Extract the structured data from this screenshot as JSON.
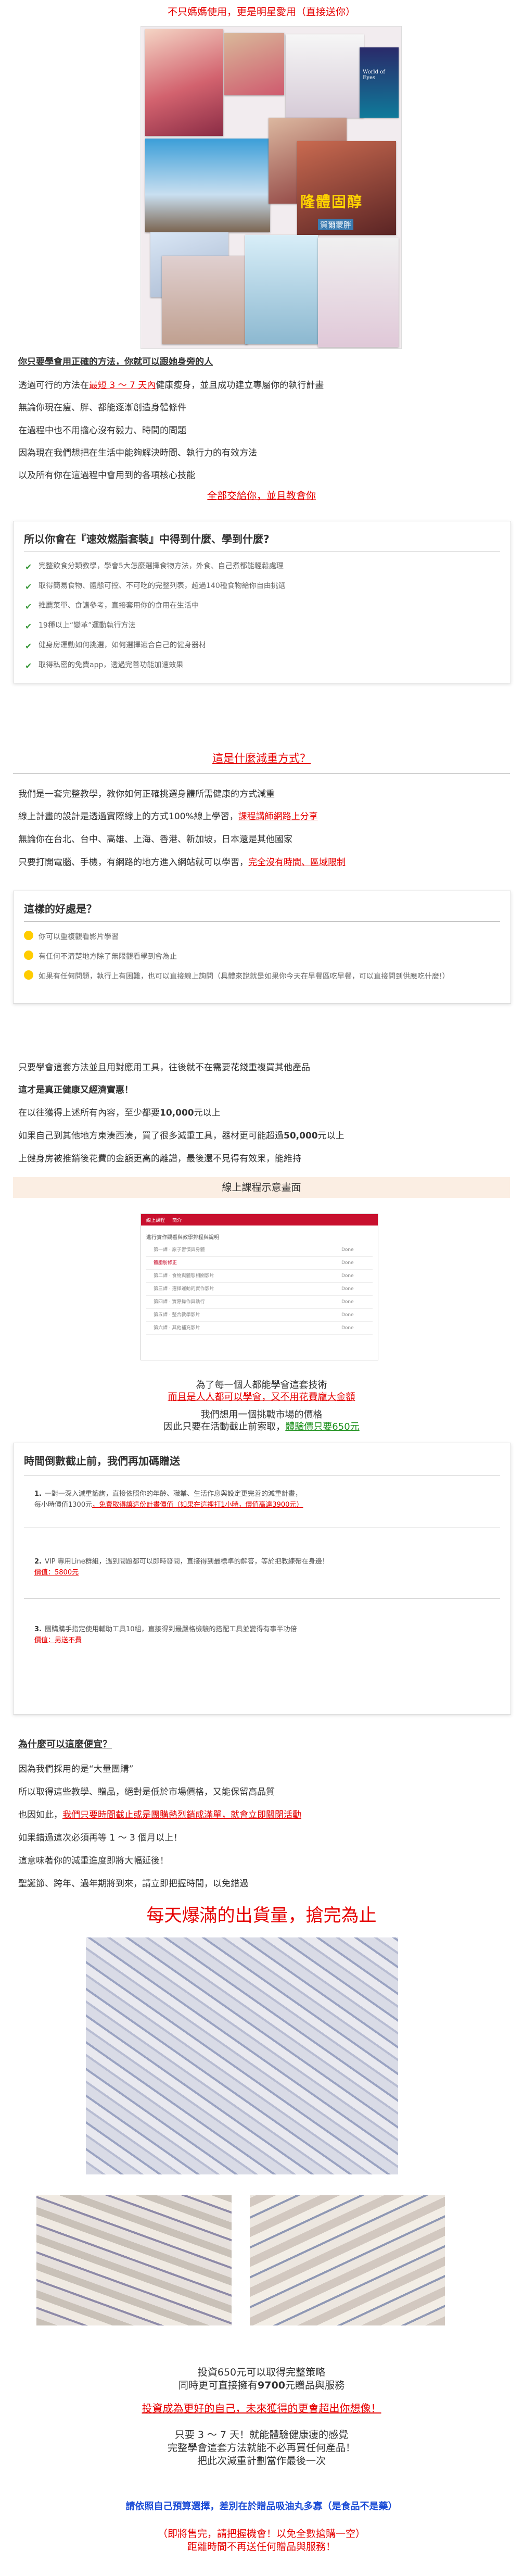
{
  "header": {
    "tagline": "不只媽媽使用，更是明星愛用（直接送你）"
  },
  "collage": {
    "caption1": "隆體固醇",
    "caption2": "賀爾蒙胖",
    "book_tag": "World of Eyes"
  },
  "intro": {
    "heading": "你只要學會用正確的方法，你就可以跟她身旁的人",
    "line1_a": "透過可行的方法在",
    "line1_b": "最短 3 ～ 7 天內",
    "line1_c": "健康瘦身，並且成功建立專屬你的執行計畫",
    "line2": "無論你現在瘦、胖、都能逐漸創造身體條件",
    "line3": "在過程中也不用擔心沒有毅力、時間的問題",
    "line4": "因為現在我們想把在生活中能夠解決時間、執行力的有效方法",
    "line5": "以及所有你在這過程中會用到的各項核心技能",
    "cta": "全部交給你，並且教會你"
  },
  "features": {
    "title": "所以你會在『速效燃脂套裝』中得到什麼、學到什麼?",
    "items": [
      "完整飲食分類教學，學會5大怎麼選擇食物方法，外食、自己煮都能輕鬆處理",
      "取得簡易食物、體態可控、不可吃的完整列表，超過140種食物給你自由挑選",
      "推薦菜單、食譜參考，直接套用你的食用在生活中",
      "19種以上“變革”運動執行方法",
      "健身房運動如何挑選，如何選擇適合自己的健身器材",
      "取得私密的免費app，透過完善功能加速效果"
    ]
  },
  "what": {
    "title": "這是什麼減重方式？",
    "l1": "我們是一套完整教學，教你如何正確挑選身體所需健康的方式減重",
    "l2a": "線上計畫的設計是透過實際線上的方式100%線上學習，",
    "l2b": "課程講師網路上分享",
    "l3": "無論你在台北、台中、高雄、上海、香港、新加坡，日本還是其他國家",
    "l4a": "只要打開電腦、手機，有網路的地方進入網站就可以學習，",
    "l4b": "完全沒有時間、區域限制"
  },
  "benefits": {
    "title": "這樣的好處是？",
    "items": [
      "你可以重複觀看影片學習",
      "有任何不清楚地方除了無限觀看學到會為止",
      "如果有任何問題，執行上有困難，也可以直接線上詢問（具體來說就是如果你今天在早餐區吃早餐，可以直接問到供應吃什麼!）"
    ]
  },
  "tools": {
    "l1": "只要學會這套方法並且用對應用工具，往後就不在需要花錢重複買其他產品",
    "l2": "這才是真正健康又經濟實惠！",
    "l3a": "在以往獲得上述所有內容，至少都要",
    "l3b": "10,000",
    "l3c": "元以上",
    "l4a": "如果自己到其他地方東湊西湊，買了很多減重工具，器材更可能超過",
    "l4b": "50,000",
    "l4c": "元以上",
    "l5": "上健身房被推銷後花費的金額更高的離譜，最後還不見得有效果，能維持"
  },
  "course": {
    "banner": "線上課程示意畫面",
    "tab1": "線上課程",
    "tab2": "簡介",
    "table_head": "進行實作觀看與教學排程與說明",
    "rows": [
      "第一課 · 原子習慣與身體",
      "體脂肪修正",
      "第二課 · 食物與體態相關影片",
      "第三課 · 選擇運動的實作影片",
      "第四課 · 實際操作與執行",
      "第五課 · 整合教學影片",
      "第六課 · 其他補充影片"
    ],
    "status": "Done"
  },
  "price_note": {
    "l1": "為了每一個人都能學會這套技術",
    "l2": "而且是人人都可以學會，又不用花費龐大金額",
    "l3": "我們想用一個挑戰市場的價格",
    "l4a": "因此只要在活動截止前索取，",
    "l4b": "體驗價只要650元"
  },
  "offer": {
    "title": "時間倒數截止前，我們再加碼贈送",
    "s1_n": "1.",
    "s1": "一對一深入減重諮詢，直接依照你的年齡、職業、生活作息與設定更完善的減重計畫，",
    "s1_b": "每小時價值1300元",
    "s1_c": "，免費取得讓這份計畫價值（如果在這裡打1小時，價值高達3900元）",
    "s2_n": "2.",
    "s2": "VIP 專用Line群組，遇到問題都可以即時發問，直接得到最標準的解答，等於把教練帶在身邊！",
    "s2_b": "價值：5800元",
    "s3_n": "3.",
    "s3": "團購購手指定使用輔助工具10組，直接得到最嚴格檢驗的搭配工具並變得有事半功倍",
    "s3_b": "價值：另送不費"
  },
  "why": {
    "q": "為什麼可以這麼便宜？",
    "l1": "因為我們採用的是“大量團購”",
    "l2": "所以取得這些教學、贈品，絕對是低於市場價格，又能保留高品質",
    "l3a": "也因如此，",
    "l3b": "我們只要時間截止或是團購熱烈銷成滿單，就會立即關閉活動",
    "l4": "如果錯過這次必須再等 1 ～ 3 個月以上！",
    "l5": "這意味著你的減重進度即將大幅延後！",
    "l6": "聖誕節、跨年、過年期將到來，請立即把握時間，以免錯過"
  },
  "shipping": {
    "title": "每天爆滿的出貨量，搶完為止"
  },
  "final": {
    "l1": "投資650元可以取得完整策略",
    "l2a": "同時更可直接擁有",
    "l2b": "9700",
    "l2c": "元贈品與服務",
    "l3": "投資成為更好的自己，未來獲得的更會超出你想像！",
    "l4": "只要 3 ～ 7 天！就能體驗健康瘦的感覺",
    "l5": "完整學會這套方法就能不必再買任何產品！",
    "l6": "把此次減重計劃當作最後一次",
    "l7": "請依照自己預算選擇，差別在於贈品吸油丸多寡（是食品不是藥）",
    "l8": "（即將售完，請把握機會！以免全數搶購一空）",
    "l9": "距離時間不再送任何贈品與服務！"
  }
}
